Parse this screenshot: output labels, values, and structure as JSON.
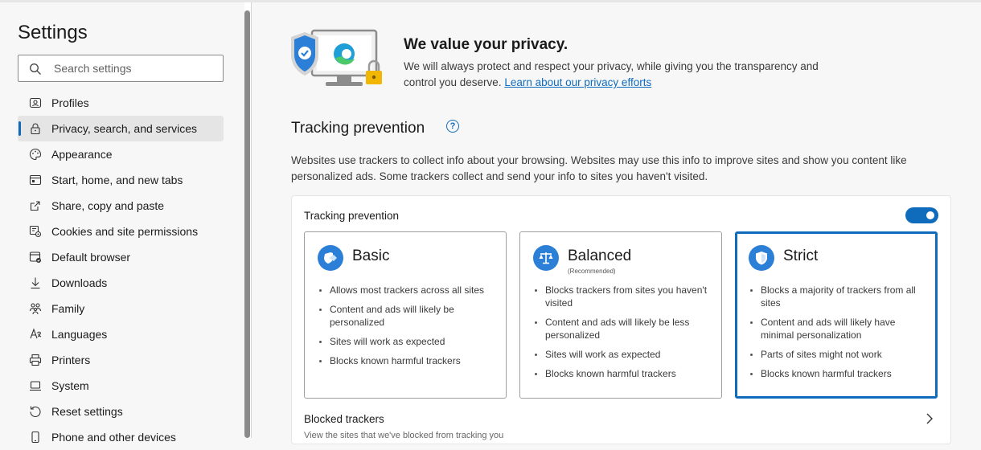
{
  "sidebar": {
    "title": "Settings",
    "search_placeholder": "Search settings",
    "items": [
      {
        "label": "Profiles",
        "icon": "profile-icon"
      },
      {
        "label": "Privacy, search, and services",
        "icon": "lock-icon",
        "active": true
      },
      {
        "label": "Appearance",
        "icon": "palette-icon"
      },
      {
        "label": "Start, home, and new tabs",
        "icon": "home-tabs-icon"
      },
      {
        "label": "Share, copy and paste",
        "icon": "share-icon"
      },
      {
        "label": "Cookies and site permissions",
        "icon": "cookie-permissions-icon"
      },
      {
        "label": "Default browser",
        "icon": "browser-icon"
      },
      {
        "label": "Downloads",
        "icon": "download-icon"
      },
      {
        "label": "Family",
        "icon": "family-icon"
      },
      {
        "label": "Languages",
        "icon": "language-icon"
      },
      {
        "label": "Printers",
        "icon": "printer-icon"
      },
      {
        "label": "System",
        "icon": "laptop-icon"
      },
      {
        "label": "Reset settings",
        "icon": "reset-icon"
      },
      {
        "label": "Phone and other devices",
        "icon": "phone-icon"
      }
    ]
  },
  "privacy": {
    "title": "We value your privacy.",
    "text": "We will always protect and respect your privacy, while giving you the transparency and control you deserve.",
    "link": "Learn about our privacy efforts"
  },
  "tracking": {
    "heading": "Tracking prevention",
    "help": "?",
    "description": "Websites use trackers to collect info about your browsing. Websites may use this info to improve sites and show you content like personalized ads. Some trackers collect and send your info to sites you haven't visited.",
    "card_label": "Tracking prevention",
    "toggle_on": true,
    "options": [
      {
        "name": "Basic",
        "recommended": "",
        "icon": "basic-tracking-icon",
        "selected": false,
        "bullets": [
          "Allows most trackers across all sites",
          "Content and ads will likely be personalized",
          "Sites will work as expected",
          "Blocks known harmful trackers"
        ]
      },
      {
        "name": "Balanced",
        "recommended": "(Recommended)",
        "icon": "balance-scale-icon",
        "selected": false,
        "bullets": [
          "Blocks trackers from sites you haven't visited",
          "Content and ads will likely be less personalized",
          "Sites will work as expected",
          "Blocks known harmful trackers"
        ]
      },
      {
        "name": "Strict",
        "recommended": "",
        "icon": "shield-icon",
        "selected": true,
        "bullets": [
          "Blocks a majority of trackers from all sites",
          "Content and ads will likely have minimal personalization",
          "Parts of sites might not work",
          "Blocks known harmful trackers"
        ]
      }
    ],
    "blocked_title": "Blocked trackers",
    "blocked_sub": "View the sites that we've blocked from tracking you"
  },
  "colors": {
    "accent": "#0f6cbd",
    "selected_bg": "#e5e5e5"
  }
}
